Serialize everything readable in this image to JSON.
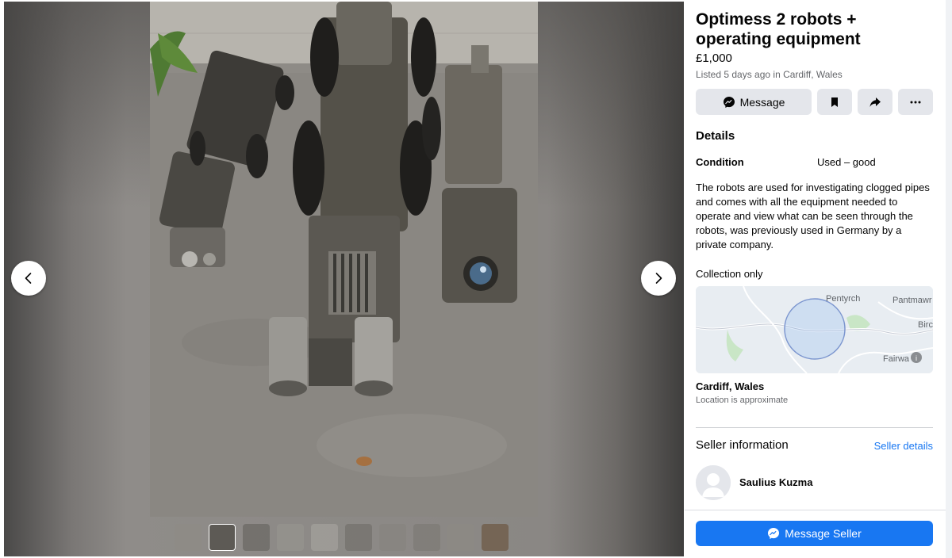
{
  "listing": {
    "title": "Optimess 2 robots + operating equipment",
    "price": "£1,000",
    "listed": "Listed 5 days ago in Cardiff, Wales"
  },
  "actions": {
    "message_label": "Message",
    "save_icon": "bookmark-icon",
    "share_icon": "share-icon",
    "more_icon": "more-icon"
  },
  "details": {
    "heading": "Details",
    "condition_label": "Condition",
    "condition_value": "Used – good",
    "description": "The robots are used for investigating clogged pipes and comes with all the equipment needed to operate and view what can be seen through the robots, was previously used in Germany by a private company.",
    "collection": "Collection only"
  },
  "map": {
    "labels": [
      "Pentyrch",
      "Pantmawr",
      "Birc",
      "Fairwa"
    ]
  },
  "location": {
    "city": "Cardiff, Wales",
    "approx": "Location is approximate"
  },
  "seller": {
    "heading": "Seller information",
    "details_link": "Seller details",
    "name": "Saulius Kuzma"
  },
  "footer": {
    "message_seller": "Message Seller"
  },
  "viewer": {
    "thumbnail_count": 10,
    "active_thumbnail": 2
  },
  "colors": {
    "accent": "#1877f2",
    "button_grey": "#e4e6eb",
    "secondary_text": "#65676b"
  }
}
